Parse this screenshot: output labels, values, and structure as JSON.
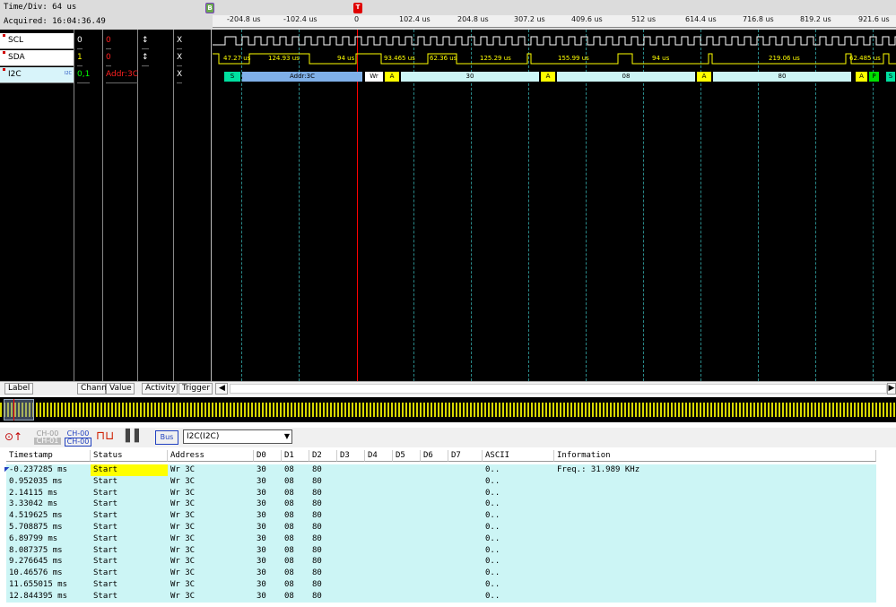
{
  "header": {
    "time_div": "Time/Div: 64 us",
    "acquired": "Acquired: 16:04:36.49"
  },
  "ruler_ticks": [
    "-204.8 us",
    "-102.4 us",
    "0",
    "102.4 us",
    "204.8 us",
    "307.2 us",
    "409.6 us",
    "512 us",
    "614.4 us",
    "716.8 us",
    "819.2 us",
    "921.6 us"
  ],
  "markers": {
    "b": "B",
    "t": "T"
  },
  "channels": [
    {
      "label": "SCL",
      "chan": "0",
      "value": "0",
      "activity": "↕",
      "trigger": "X"
    },
    {
      "label": "SDA",
      "chan": "1",
      "value": "0",
      "activity": "↕",
      "trigger": "X"
    },
    {
      "label": "I2C",
      "chan": "0,1",
      "value": "Addr:3C",
      "activity": "",
      "trigger": "X",
      "sub": "I2C"
    }
  ],
  "sda_timings": [
    "47.27 us",
    "124.93 us",
    "94 us",
    "93.465 us",
    "62.36 us",
    "125.29 us",
    "155.99 us",
    "94 us",
    "219.06 us",
    "62.485 us"
  ],
  "i2c_decode": {
    "start": "S",
    "addr": "Addr:3C",
    "wr": "Wr",
    "ack": "A",
    "d0": "30",
    "d1": "08",
    "d2": "80",
    "stop": "P",
    "start2": "S"
  },
  "tabs": {
    "label": "Label",
    "chan": "Chann",
    "value": "Value",
    "activity": "Activity",
    "trigger": "Trigger"
  },
  "toolbar": {
    "ch_a1": "CH-00",
    "ch_a2": "CH-01",
    "ch_b1": "CH-00",
    "ch_b2": "CH-00",
    "bus": "Bus",
    "selected_bus": "I2C(I2C)"
  },
  "table": {
    "columns": [
      "Timestamp",
      "Status",
      "Address",
      "D0",
      "D1",
      "D2",
      "D3",
      "D4",
      "D5",
      "D6",
      "D7",
      "ASCII",
      "Information"
    ],
    "rows": [
      {
        "ts": "-0.237285 ms",
        "status": "Start",
        "addr": "Wr 3C",
        "d0": "30",
        "d1": "08",
        "d2": "80",
        "ascii": "0..",
        "info": "Freq.: 31.989 KHz"
      },
      {
        "ts": "0.952035 ms",
        "status": "Start",
        "addr": "Wr 3C",
        "d0": "30",
        "d1": "08",
        "d2": "80",
        "ascii": "0..",
        "info": ""
      },
      {
        "ts": "2.14115 ms",
        "status": "Start",
        "addr": "Wr 3C",
        "d0": "30",
        "d1": "08",
        "d2": "80",
        "ascii": "0..",
        "info": ""
      },
      {
        "ts": "3.33042 ms",
        "status": "Start",
        "addr": "Wr 3C",
        "d0": "30",
        "d1": "08",
        "d2": "80",
        "ascii": "0..",
        "info": ""
      },
      {
        "ts": "4.519625 ms",
        "status": "Start",
        "addr": "Wr 3C",
        "d0": "30",
        "d1": "08",
        "d2": "80",
        "ascii": "0..",
        "info": ""
      },
      {
        "ts": "5.708875 ms",
        "status": "Start",
        "addr": "Wr 3C",
        "d0": "30",
        "d1": "08",
        "d2": "80",
        "ascii": "0..",
        "info": ""
      },
      {
        "ts": "6.89799 ms",
        "status": "Start",
        "addr": "Wr 3C",
        "d0": "30",
        "d1": "08",
        "d2": "80",
        "ascii": "0..",
        "info": ""
      },
      {
        "ts": "8.087375 ms",
        "status": "Start",
        "addr": "Wr 3C",
        "d0": "30",
        "d1": "08",
        "d2": "80",
        "ascii": "0..",
        "info": ""
      },
      {
        "ts": "9.276645 ms",
        "status": "Start",
        "addr": "Wr 3C",
        "d0": "30",
        "d1": "08",
        "d2": "80",
        "ascii": "0..",
        "info": ""
      },
      {
        "ts": "10.46576 ms",
        "status": "Start",
        "addr": "Wr 3C",
        "d0": "30",
        "d1": "08",
        "d2": "80",
        "ascii": "0..",
        "info": ""
      },
      {
        "ts": "11.655015 ms",
        "status": "Start",
        "addr": "Wr 3C",
        "d0": "30",
        "d1": "08",
        "d2": "80",
        "ascii": "0..",
        "info": ""
      },
      {
        "ts": "12.844395 ms",
        "status": "Start",
        "addr": "Wr 3C",
        "d0": "30",
        "d1": "08",
        "d2": "80",
        "ascii": "0..",
        "info": ""
      }
    ]
  },
  "colors": {
    "bus_cyan": "#ccf5f5",
    "ack_yellow": "#ffff00",
    "wave_bg": "#000000",
    "trigger_red": "#ff0000",
    "grid_cyan": "#2a8a8a",
    "addr_blue": "#7fb0e8"
  }
}
